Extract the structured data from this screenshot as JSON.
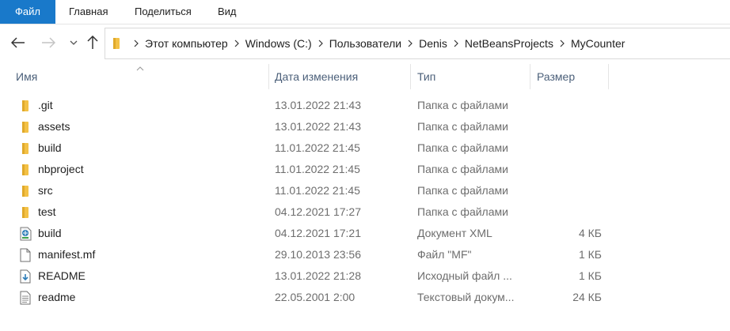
{
  "ribbon": {
    "tabs": [
      {
        "label": "Файл",
        "active": true
      },
      {
        "label": "Главная"
      },
      {
        "label": "Поделиться"
      },
      {
        "label": "Вид"
      }
    ]
  },
  "address": {
    "crumbs": [
      "Этот компьютер",
      "Windows (C:)",
      "Пользователи",
      "Denis",
      "NetBeansProjects",
      "MyCounter"
    ]
  },
  "columns": {
    "name": "Имя",
    "date": "Дата изменения",
    "type": "Тип",
    "size": "Размер"
  },
  "files": [
    {
      "name": ".git",
      "date": "13.01.2022 21:43",
      "type": "Папка с файлами",
      "size": "",
      "icon": "folder-icon"
    },
    {
      "name": "assets",
      "date": "13.01.2022 21:43",
      "type": "Папка с файлами",
      "size": "",
      "icon": "folder-icon"
    },
    {
      "name": "build",
      "date": "11.01.2022 21:45",
      "type": "Папка с файлами",
      "size": "",
      "icon": "folder-icon"
    },
    {
      "name": "nbproject",
      "date": "11.01.2022 21:45",
      "type": "Папка с файлами",
      "size": "",
      "icon": "folder-icon"
    },
    {
      "name": "src",
      "date": "11.01.2022 21:45",
      "type": "Папка с файлами",
      "size": "",
      "icon": "folder-icon"
    },
    {
      "name": "test",
      "date": "04.12.2021 17:27",
      "type": "Папка с файлами",
      "size": "",
      "icon": "folder-icon"
    },
    {
      "name": "build",
      "date": "04.12.2021 17:21",
      "type": "Документ XML",
      "size": "4 КБ",
      "icon": "xml-file-icon"
    },
    {
      "name": "manifest.mf",
      "date": "29.10.2013 23:56",
      "type": "Файл \"MF\"",
      "size": "1 КБ",
      "icon": "blank-file-icon"
    },
    {
      "name": "README",
      "date": "13.01.2022 21:28",
      "type": "Исходный файл ...",
      "size": "1 КБ",
      "icon": "source-file-icon"
    },
    {
      "name": "readme",
      "date": "22.05.2001 2:00",
      "type": "Текстовый докум...",
      "size": "24 КБ",
      "icon": "text-file-icon"
    }
  ],
  "colors": {
    "accent": "#1979ca",
    "folder": "#f3c146",
    "header_text": "#4c607a",
    "meta_text": "#6d6d6d"
  }
}
